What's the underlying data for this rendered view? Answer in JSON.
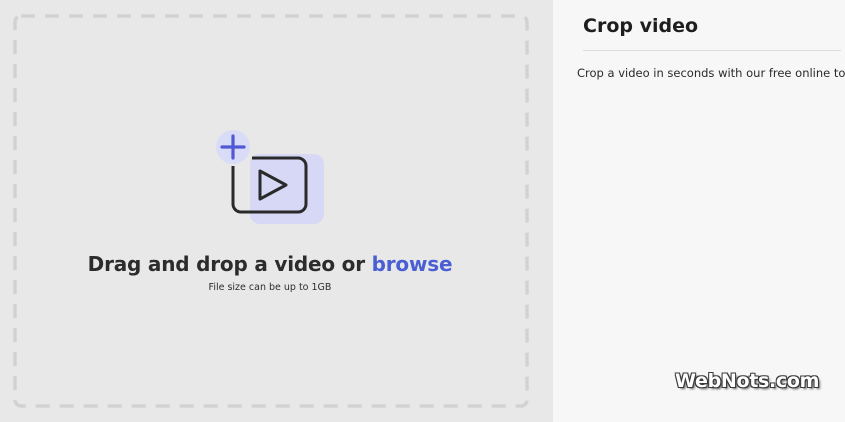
{
  "drop": {
    "title_prefix": "Drag and drop a video or ",
    "browse_label": "browse",
    "subtitle": "File size can be up to 1GB"
  },
  "panel": {
    "title": "Crop video",
    "description": "Crop a video in seconds with our free online tool."
  },
  "watermark": "WebNots.com",
  "colors": {
    "accent": "#4a5fd4",
    "plus_bg": "#d9dcf7",
    "plus_stroke": "#5258d6",
    "icon_shadow": "#d6d8f6"
  },
  "icons": {
    "upload": "add-video-icon"
  }
}
